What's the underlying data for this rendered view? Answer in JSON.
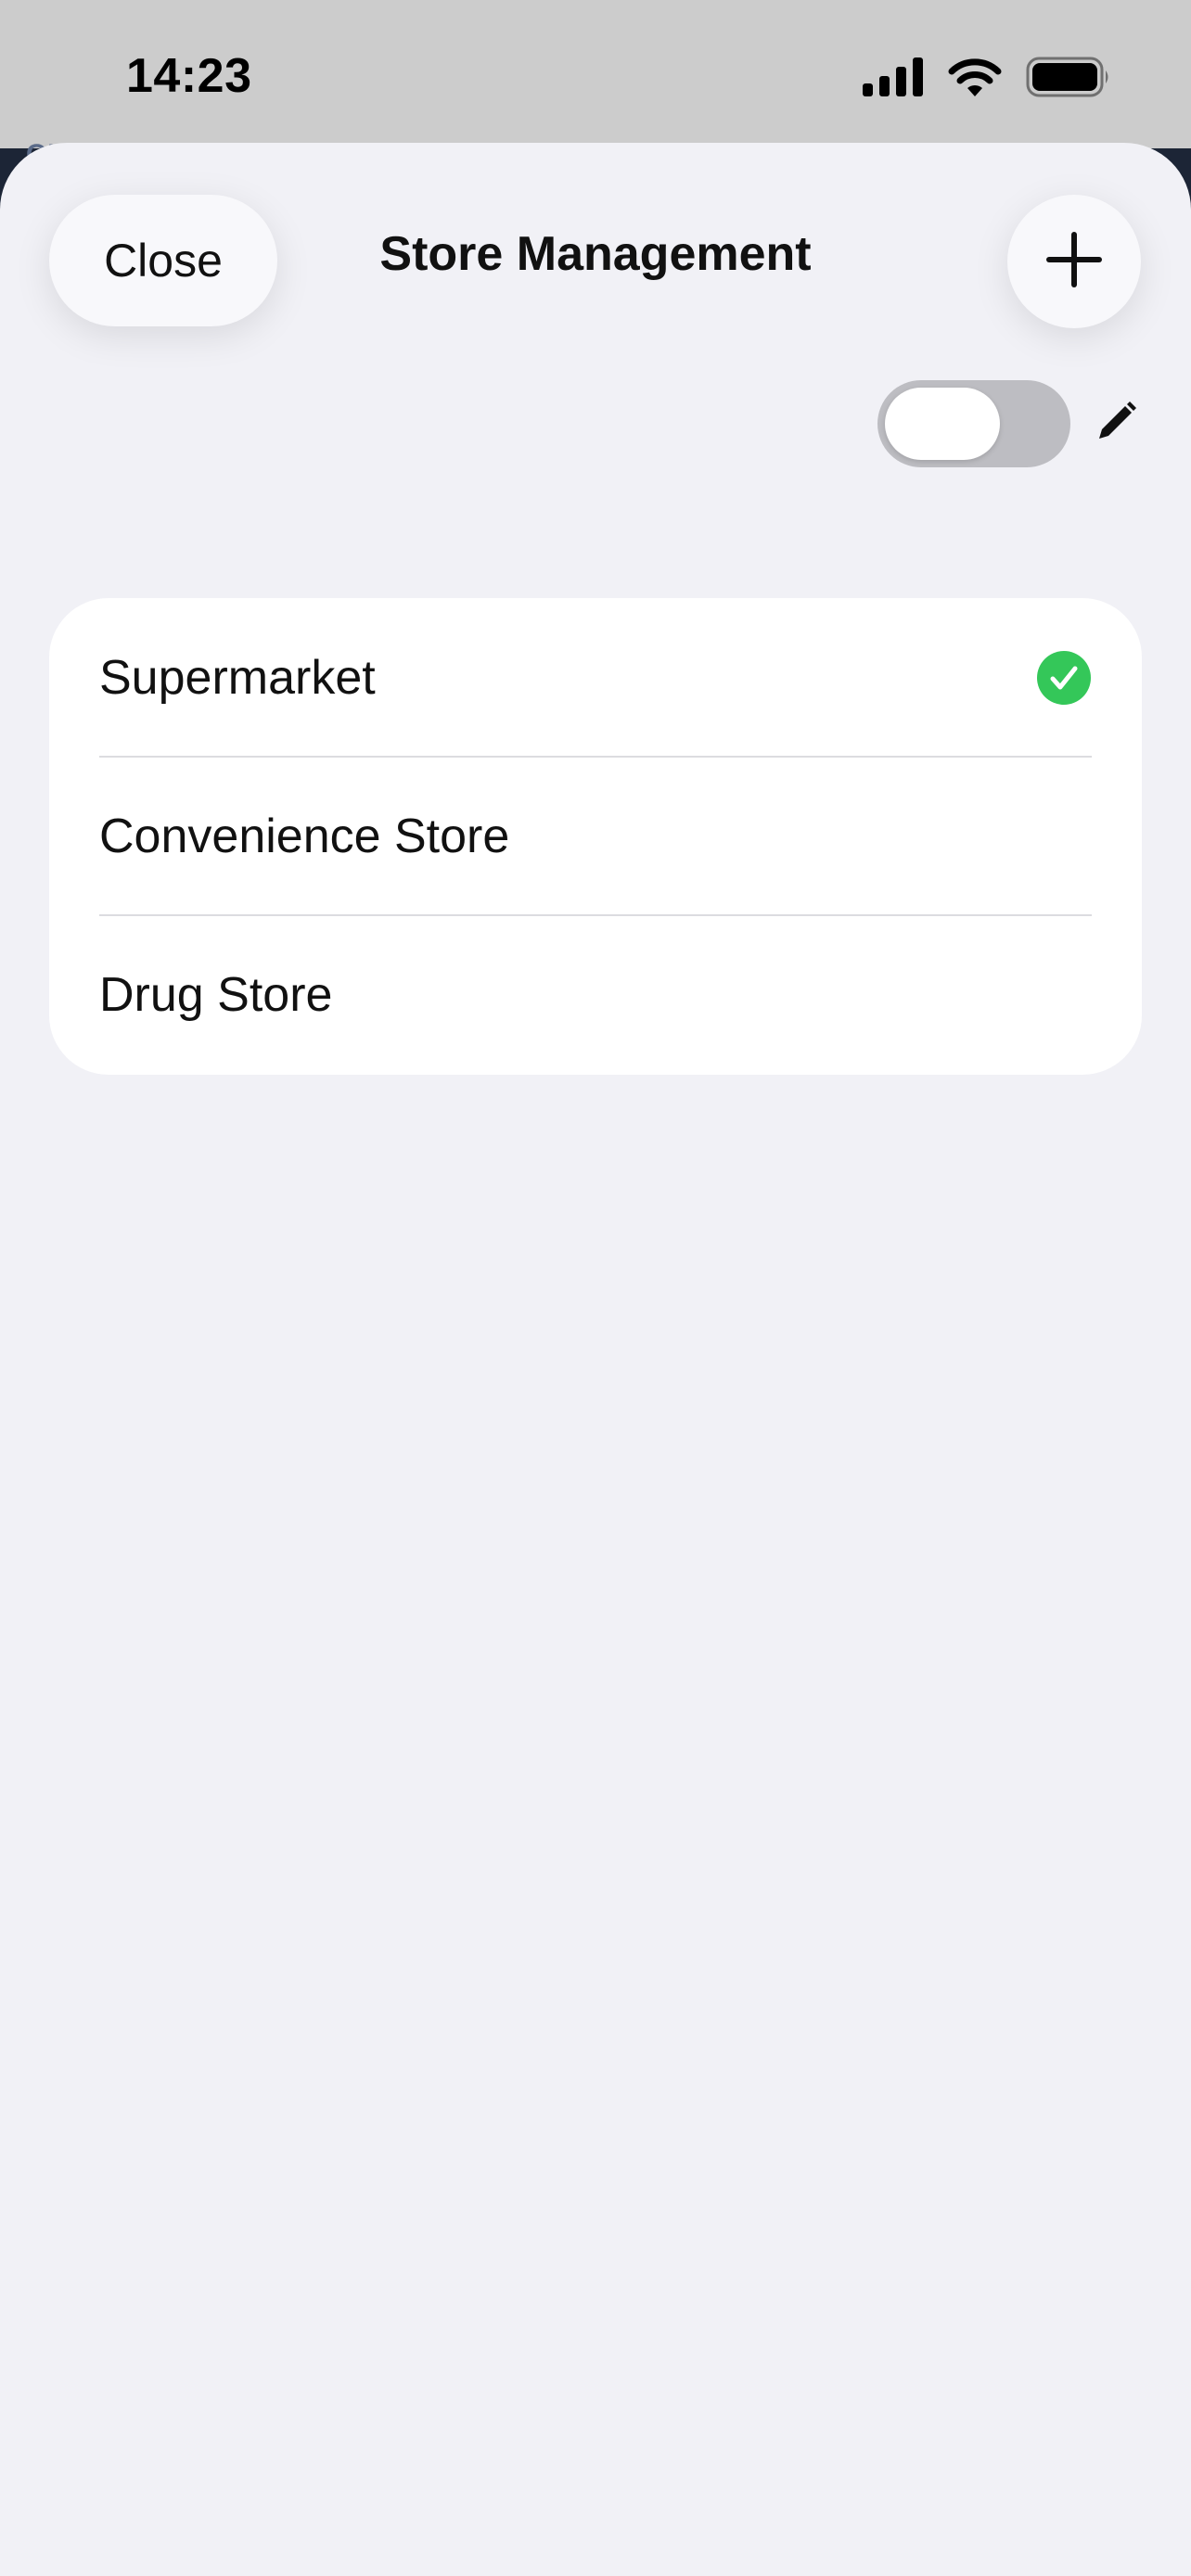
{
  "status_bar": {
    "time": "14:23",
    "icons": [
      "cellular-signal-icon",
      "wifi-icon",
      "battery-icon"
    ]
  },
  "background_peek_text": "OU",
  "sheet": {
    "title": "Store Management",
    "close_label": "Close",
    "add_icon": "plus-icon",
    "edit_icon": "pencil-icon",
    "edit_mode_toggle_on": false
  },
  "stores": [
    {
      "name": "Supermarket",
      "selected": true
    },
    {
      "name": "Convenience Store",
      "selected": false
    },
    {
      "name": "Drug Store",
      "selected": false
    }
  ],
  "colors": {
    "sheet_background": "#f1f1f6",
    "status_bar": "#cccccc",
    "selected_check": "#34c759",
    "toggle_off_track": "#bdbdc2"
  }
}
